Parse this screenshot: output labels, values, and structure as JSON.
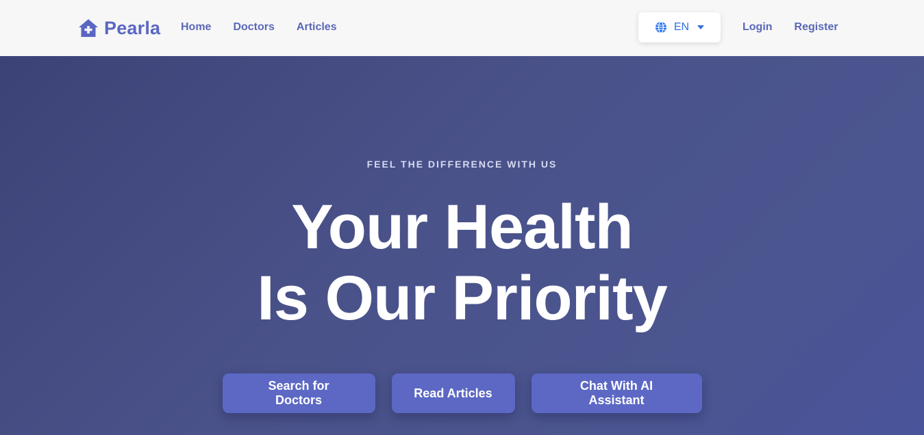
{
  "navbar": {
    "brand": {
      "name": "Pearla",
      "icon": "house-medical-icon"
    },
    "links": [
      {
        "label": "Home"
      },
      {
        "label": "Doctors"
      },
      {
        "label": "Articles"
      }
    ],
    "language": {
      "label": "EN",
      "icon": "globe-icon",
      "caret": "caret-down-icon"
    },
    "auth": {
      "login": "Login",
      "register": "Register"
    }
  },
  "hero": {
    "eyebrow": "FEEL THE DIFFERENCE WITH US",
    "headline_line1": "Your Health",
    "headline_line2": "Is Our Priority",
    "buttons": [
      {
        "label": "Search for Doctors"
      },
      {
        "label": "Read Articles"
      },
      {
        "label": "Chat With AI Assistant"
      }
    ]
  },
  "colors": {
    "brand": "#5a67c2",
    "accent_button": "#5c68c4",
    "hero_background": "#434b82",
    "link_blue": "#2f6fe0"
  }
}
